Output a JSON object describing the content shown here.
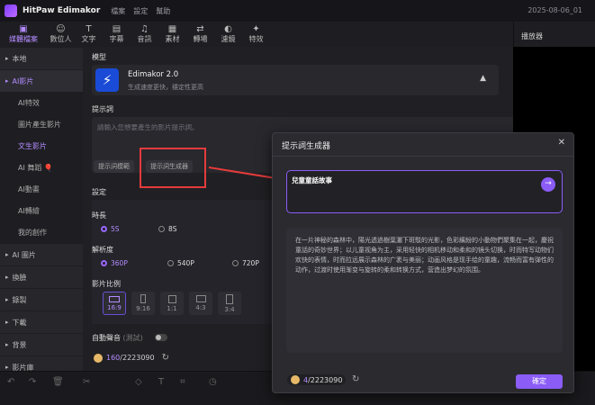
{
  "titlebar": {
    "app": "HitPaw Edimakor",
    "menu": [
      "檔案",
      "設定",
      "幫助"
    ],
    "date": "2025-08-06_01"
  },
  "toolbar": {
    "items": [
      {
        "icon": "media-icon",
        "glyph": "▣",
        "label": "媒體檔案",
        "active": true
      },
      {
        "icon": "avatar-icon",
        "glyph": "☺",
        "label": "數位人",
        "active": false
      },
      {
        "icon": "text-icon",
        "glyph": "T",
        "label": "文字",
        "active": false
      },
      {
        "icon": "subtitle-icon",
        "glyph": "▤",
        "label": "字幕",
        "active": false
      },
      {
        "icon": "audio-icon",
        "glyph": "♫",
        "label": "音訊",
        "active": false
      },
      {
        "icon": "material-icon",
        "glyph": "▦",
        "label": "素材",
        "active": false
      },
      {
        "icon": "transition-icon",
        "glyph": "⇄",
        "label": "轉場",
        "active": false
      },
      {
        "icon": "filter-icon",
        "glyph": "◐",
        "label": "濾鏡",
        "active": false
      },
      {
        "icon": "effect-icon",
        "glyph": "✦",
        "label": "特效",
        "active": false
      }
    ]
  },
  "player": {
    "title": "播放器"
  },
  "sidebar": {
    "items": [
      {
        "label": "本地",
        "type": "cat",
        "selected": false
      },
      {
        "label": "AI影片",
        "type": "cat",
        "selected": true
      },
      {
        "label": "AI特效",
        "type": "sub",
        "selected": false
      },
      {
        "label": "圖片產生影片",
        "type": "sub",
        "selected": false
      },
      {
        "label": "文生影片",
        "type": "sub",
        "selected": true
      },
      {
        "label": "AI 舞蹈 🎈",
        "type": "sub",
        "selected": false
      },
      {
        "label": "AI動畫",
        "type": "sub",
        "selected": false
      },
      {
        "label": "AI轉繪",
        "type": "sub",
        "selected": false
      },
      {
        "label": "我的創作",
        "type": "sub",
        "selected": false
      },
      {
        "label": "AI 圖片",
        "type": "cat",
        "selected": false
      },
      {
        "label": "換臉",
        "type": "cat",
        "selected": false
      },
      {
        "label": "錄製",
        "type": "cat",
        "selected": false
      },
      {
        "label": "下載",
        "type": "cat",
        "selected": false
      },
      {
        "label": "背景",
        "type": "cat",
        "selected": false
      },
      {
        "label": "影片庫",
        "type": "cat",
        "selected": false
      }
    ]
  },
  "main": {
    "model_label": "模型",
    "model": {
      "name": "Edimakor 2.0",
      "desc": "生成速度更快，穩定性更高"
    },
    "prompt_label": "提示詞",
    "prompt_placeholder": "請輸入您想要產生的影片提示詞。",
    "template_btn": "提示詞模範",
    "generator_btn": "提示詞生成器",
    "settings_label": "設定",
    "duration_label": "時長",
    "durations": [
      {
        "label": "5S",
        "selected": true
      },
      {
        "label": "8S",
        "selected": false
      }
    ],
    "resolution_label": "解析度",
    "resolutions": [
      {
        "label": "360P",
        "selected": true
      },
      {
        "label": "540P",
        "selected": false
      },
      {
        "label": "720P",
        "selected": false
      }
    ],
    "ratio_label": "影片比例",
    "ratios": [
      {
        "label": "16:9",
        "selected": true
      },
      {
        "label": "9:16",
        "selected": false
      },
      {
        "label": "1:1",
        "selected": false
      },
      {
        "label": "4:3",
        "selected": false
      },
      {
        "label": "3:4",
        "selected": false
      }
    ],
    "auto_audio": "自動聲音",
    "auto_audio_note": "(測試)",
    "credits_used": "160",
    "credits_total": "/2223090"
  },
  "dialog": {
    "title": "提示詞生成器",
    "input": "兒童童話故事",
    "result": "在一片神秘的森林中，陽光透過樹葉灑下斑駁的光影，色彩繽紛的小動物們聚集在一起，慶祝童話的奇妙世界；以儿童视角为主，采用轻快的相机移动和柔和的镜头切换，时而特写动物们欢快的表情，时而拉远展示森林的广袤与美丽；动画风格是现手绘的童趣，流畅而富有弹性的动作，过渡时使用渐变与旋转的柔和转换方式，营造出梦幻的氛围。",
    "credits_used": "4",
    "credits_total": "/2223090",
    "ok": "確定"
  },
  "colors": {
    "accent": "#8b5cf6",
    "highlight": "#e53b3b"
  }
}
